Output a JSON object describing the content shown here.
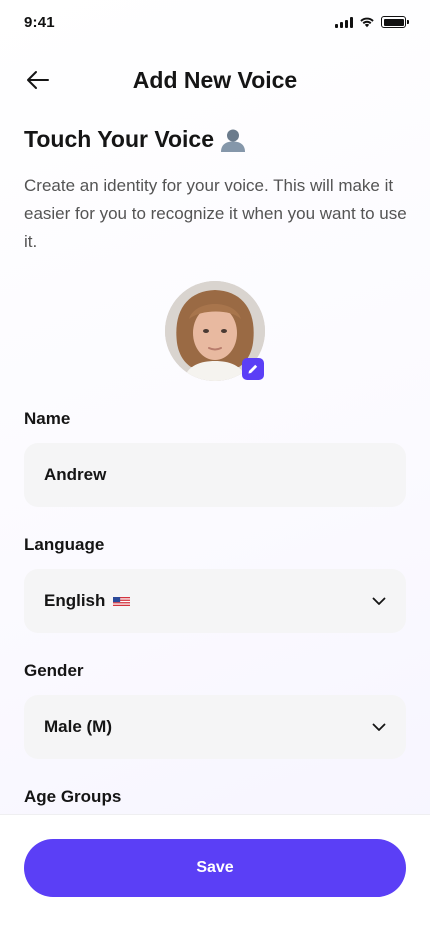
{
  "status_bar": {
    "time": "9:41"
  },
  "header": {
    "title": "Add New Voice",
    "back_icon": "arrow-left-icon"
  },
  "intro": {
    "title": "Touch Your Voice",
    "title_icon": "person-silhouette-icon",
    "description": "Create an identity for your voice. This will make it easier for you to recognize it when you want to use it."
  },
  "avatar": {
    "edit_icon": "pencil-icon"
  },
  "form": {
    "name": {
      "label": "Name",
      "value": "Andrew"
    },
    "language": {
      "label": "Language",
      "value": "English",
      "flag_icon": "us-flag-icon"
    },
    "gender": {
      "label": "Gender",
      "value": "Male (M)"
    },
    "age_groups": {
      "label": "Age Groups"
    }
  },
  "footer": {
    "save_label": "Save"
  },
  "colors": {
    "accent": "#5b3ff6",
    "field_bg": "#f5f5f6"
  }
}
